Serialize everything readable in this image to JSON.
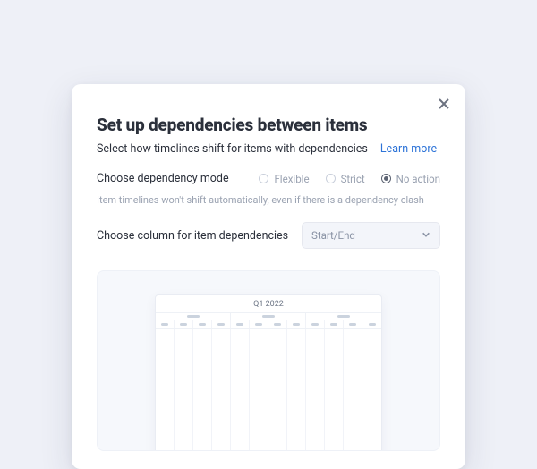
{
  "modal": {
    "title": "Set up dependencies between items",
    "subtitle": "Select how timelines shift for items with dependencies",
    "learn_more": "Learn more",
    "mode_label": "Choose dependency mode",
    "modes": {
      "flexible": "Flexible",
      "strict": "Strict",
      "none": "No action"
    },
    "selected_mode": "none",
    "mode_hint": "Item timelines won't shift automatically, even if there is a dependency clash",
    "column_label": "Choose column for item dependencies",
    "column_value": "Start/End"
  },
  "preview": {
    "period": "Q1 2022"
  }
}
